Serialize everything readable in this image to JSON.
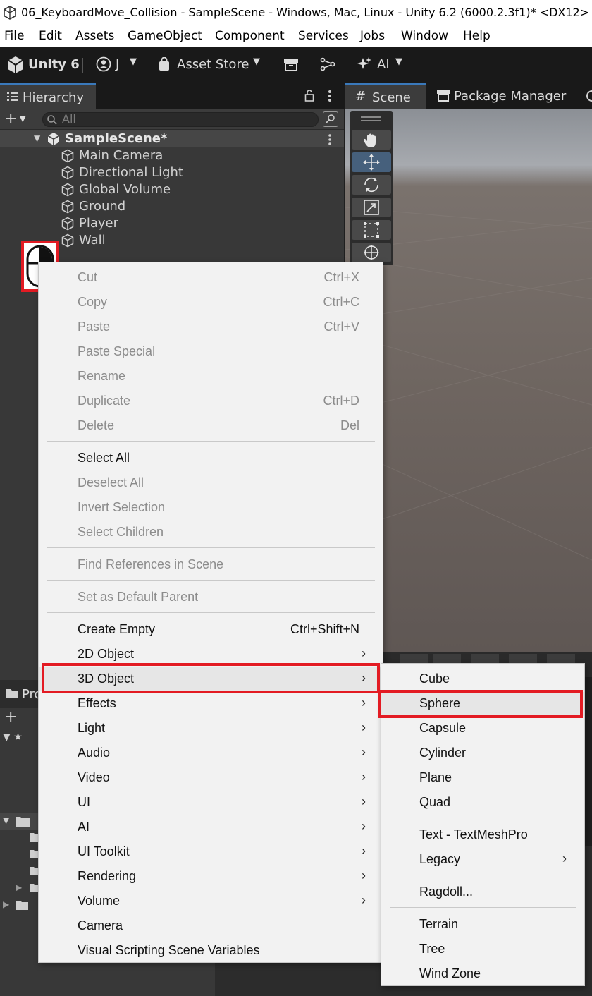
{
  "window": {
    "title": "06_KeyboardMove_Collision - SampleScene - Windows, Mac, Linux - Unity 6.2 (6000.2.3f1)* <DX12>"
  },
  "menubar": [
    "File",
    "Edit",
    "Assets",
    "GameObject",
    "Component",
    "Services",
    "Jobs",
    "Window",
    "Help"
  ],
  "toolbar": {
    "brand": "Unity 6",
    "account": "J",
    "asset_store": "Asset Store",
    "ai": "AI"
  },
  "hierarchy": {
    "tab_label": "Hierarchy",
    "search_placeholder": "All",
    "scene_name": "SampleScene*",
    "objects": [
      "Main Camera",
      "Directional Light",
      "Global Volume",
      "Ground",
      "Player",
      "Wall"
    ]
  },
  "scene_tabs": {
    "scene": "Scene",
    "package_manager": "Package Manager"
  },
  "context_menu": {
    "edit_items": [
      {
        "label": "Cut",
        "shortcut": "Ctrl+X"
      },
      {
        "label": "Copy",
        "shortcut": "Ctrl+C"
      },
      {
        "label": "Paste",
        "shortcut": "Ctrl+V"
      },
      {
        "label": "Paste Special",
        "shortcut": ""
      },
      {
        "label": "Rename",
        "shortcut": ""
      },
      {
        "label": "Duplicate",
        "shortcut": "Ctrl+D"
      },
      {
        "label": "Delete",
        "shortcut": "Del"
      }
    ],
    "selection_items": [
      "Select All",
      "Deselect All",
      "Invert Selection",
      "Select Children"
    ],
    "find_references": "Find References in Scene",
    "set_default_parent": "Set as Default Parent",
    "create_empty": {
      "label": "Create Empty",
      "shortcut": "Ctrl+Shift+N"
    },
    "create_items": [
      "2D Object",
      "3D Object",
      "Effects",
      "Light",
      "Audio",
      "Video",
      "UI",
      "AI",
      "UI Toolkit",
      "Rendering",
      "Volume",
      "Camera",
      "Visual Scripting Scene Variables"
    ]
  },
  "submenu_3d": {
    "primitives": [
      "Cube",
      "Sphere",
      "Capsule",
      "Cylinder",
      "Plane",
      "Quad"
    ],
    "text": [
      "Text - TextMeshPro",
      "Legacy"
    ],
    "ragdoll": "Ragdoll...",
    "environment": [
      "Terrain",
      "Tree",
      "Wind Zone"
    ]
  },
  "lower_panel": {
    "project_tab_fragment": "Pro"
  },
  "highlight_color": "#e31b23"
}
